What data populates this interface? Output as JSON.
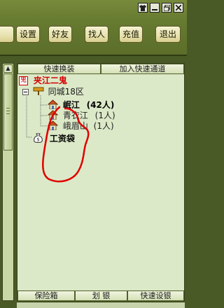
{
  "window": {
    "controls": [
      "shirt-icon",
      "minimize-icon",
      "restore-icon",
      "close-icon"
    ]
  },
  "nav": {
    "buttons": [
      {
        "label": ""
      },
      {
        "label": "设置"
      },
      {
        "label": "好友"
      },
      {
        "label": "找人"
      },
      {
        "label": "充值"
      },
      {
        "label": "退出"
      }
    ]
  },
  "tabs": {
    "quick_switch": "快速换装",
    "add_quick_channel": "加入快速通道"
  },
  "tree": {
    "user_badge": "鬼",
    "user_name": "夹江二鬼",
    "city_node": "同城18区",
    "channels": [
      {
        "name": "岷江",
        "count": "(42人)"
      },
      {
        "name": "青衣江",
        "count": "(1人)"
      },
      {
        "name": "峨眉山",
        "count": "(1人)"
      }
    ],
    "wage_bag": "工资袋"
  },
  "bottom": {
    "safe_box": "保险箱",
    "transfer": "划 银",
    "quick_bank": "快速设银"
  },
  "colors": {
    "user_name": "#d40000",
    "annotation": "#e00000",
    "panel_bg": "#dce9c8"
  }
}
